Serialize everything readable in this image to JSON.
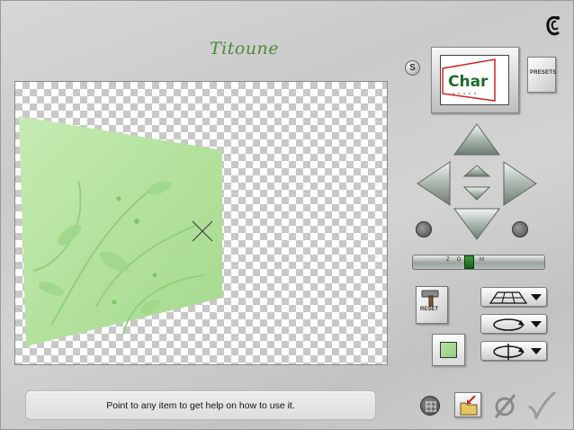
{
  "app": {
    "brand": "Titoune",
    "logo_icon": "c-swirl-logo-icon"
  },
  "thumbnail": {
    "text": "Char"
  },
  "buttons": {
    "s_label": "S",
    "presets_label": "PRESETS",
    "reset_label": "RESET"
  },
  "zoom": {
    "label": "ZOOM",
    "position_percent": 42
  },
  "mode_buttons": [
    {
      "icon": "perspective-grid-icon"
    },
    {
      "icon": "rotate-loop-icon"
    },
    {
      "icon": "flip-loop-icon"
    }
  ],
  "help": {
    "text": "Point to any item to get help on how to use it."
  },
  "colors": {
    "accent": "#4e8a3a",
    "content_green": "#b6e3a0",
    "zoom_thumb": "#2f7f2f"
  }
}
